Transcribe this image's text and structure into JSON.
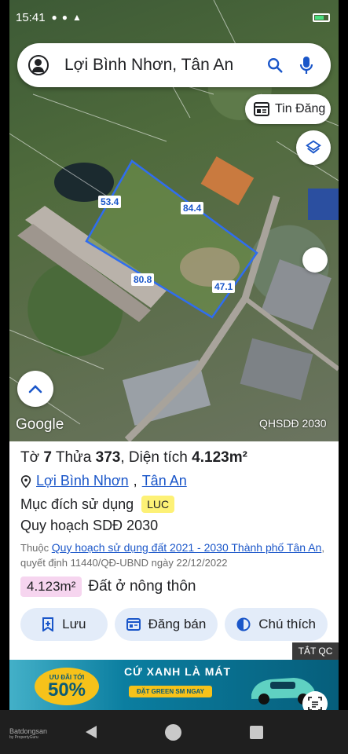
{
  "status_bar": {
    "time": "15:41"
  },
  "search": {
    "query": "Lợi Bình Nhơn, Tân An"
  },
  "map": {
    "tin_dang_label": "Tin Đăng",
    "google_label": "Google",
    "layer_label": "QHSDĐ 2030",
    "dimensions": [
      "53.4",
      "84.4",
      "80.8",
      "47.1"
    ]
  },
  "parcel": {
    "title_prefix": "Tờ",
    "sheet": "7",
    "plot_prefix": "Thửa",
    "plot": "373",
    "area_prefix": ", Diện tích",
    "area": "4.123m²",
    "ward": "Lợi Bình Nhơn",
    "separator": ",",
    "city": "Tân An",
    "purpose_label": "Mục đích sử dụng",
    "purpose_code": "LUC",
    "plan_label": "Quy hoạch SDĐ 2030",
    "source_prefix": "Thuộc",
    "source_link": "Quy hoạch sử dụng đất 2021 - 2030 Thành phố Tân An",
    "source_decision": ", quyết định 11440/QĐ-UBND ngày 22/12/2022",
    "area_chip": "4.123m²",
    "land_type": "Đất ở nông thôn"
  },
  "actions": {
    "save": "Lưu",
    "post": "Đăng bán",
    "legend": "Chú thích"
  },
  "ad": {
    "close_label": "TẮT QC",
    "badge_small": "ƯU ĐÃI TỚI",
    "badge_pct": "50%",
    "headline": "CỨ XANH LÀ MÁT",
    "cta": "ĐẶT GREEN SM NGAY"
  },
  "navbar": {
    "brand": "Batdongsan",
    "brand_sub": "by PropertyGuru"
  },
  "colors": {
    "link": "#1a56c9",
    "parcel_outline": "#2f6df0",
    "badge": "#fdf176",
    "area_chip": "#f6d5ef",
    "action_bg": "#e3ecf9"
  }
}
